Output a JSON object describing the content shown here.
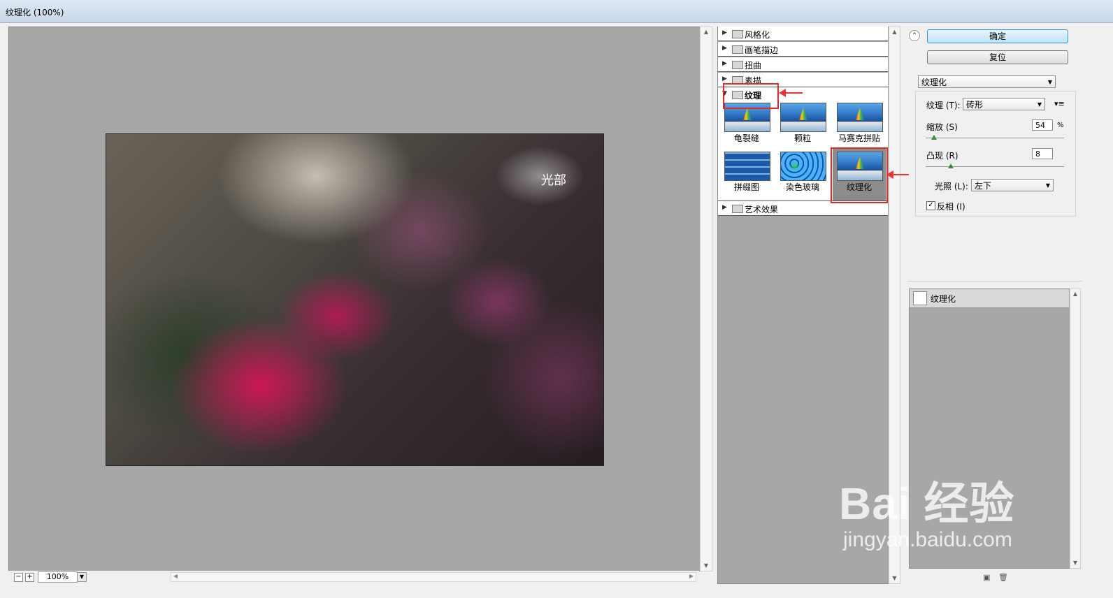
{
  "window": {
    "title": "纹理化 (100%)"
  },
  "preview": {
    "watermark": "光部",
    "zoom": "100%"
  },
  "gallery": {
    "categories": [
      {
        "label": "风格化",
        "expanded": false
      },
      {
        "label": "画笔描边",
        "expanded": false
      },
      {
        "label": "扭曲",
        "expanded": false
      },
      {
        "label": "素描",
        "expanded": false
      },
      {
        "label": "纹理",
        "expanded": true
      },
      {
        "label": "艺术效果",
        "expanded": false
      }
    ],
    "filters": [
      {
        "label": "龟裂缝",
        "style": "sea"
      },
      {
        "label": "颗粒",
        "style": "sea"
      },
      {
        "label": "马赛克拼贴",
        "style": "sea"
      },
      {
        "label": "拼缀图",
        "style": "tile"
      },
      {
        "label": "染色玻璃",
        "style": "glass"
      },
      {
        "label": "纹理化",
        "style": "sea",
        "selected": true
      }
    ]
  },
  "actions": {
    "ok": "确定",
    "reset": "复位"
  },
  "filter_select": {
    "value": "纹理化"
  },
  "settings": {
    "texture_label": "纹理 (T):",
    "texture_value": "砖形",
    "scaling_label": "缩放 (S)",
    "scaling_value": "54",
    "scaling_unit": "%",
    "scaling_fraction": 0.04,
    "relief_label": "凸现 (R)",
    "relief_value": "8",
    "relief_fraction": 0.16,
    "light_label": "光照 (L):",
    "light_value": "左下",
    "invert_label": "反相 (I)",
    "invert_checked": true
  },
  "layers": {
    "items": [
      "纹理化"
    ]
  },
  "watermark": {
    "line1": "Bai 经验",
    "line2": "jingyan.baidu.com"
  },
  "colors": {
    "highlight": "#e02a2a",
    "preview_bg": "#a7a7a7",
    "ok_border": "#3a8fd8"
  }
}
